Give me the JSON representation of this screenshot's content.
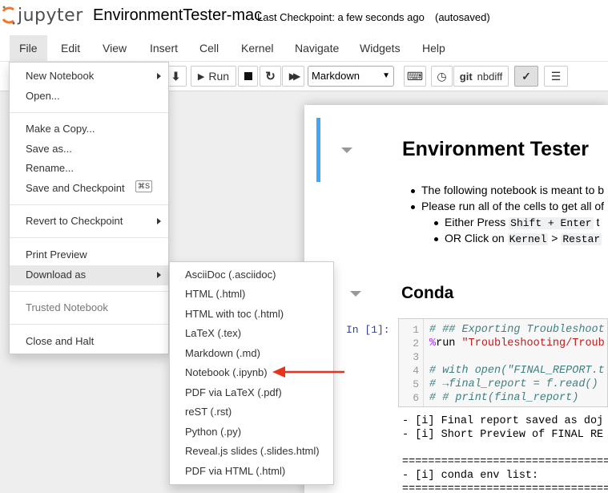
{
  "header": {
    "logo_text": "jupyter",
    "notebook_title": "EnvironmentTester-mac",
    "checkpoint": "Last Checkpoint: a few seconds ago",
    "autosave": "(autosaved)"
  },
  "menubar": [
    "File",
    "Edit",
    "View",
    "Insert",
    "Cell",
    "Kernel",
    "Navigate",
    "Widgets",
    "Help"
  ],
  "toolbar": {
    "run_label": "Run",
    "cell_type": "Markdown",
    "git_label": "git",
    "nbdiff_label": "nbdiff",
    "icons": [
      "arrow-down-icon",
      "play-icon",
      "stop-icon",
      "restart-icon",
      "fast-forward-icon",
      "keyboard-icon",
      "history-icon",
      "git-icon",
      "spellcheck-icon",
      "list-icon"
    ]
  },
  "file_menu": {
    "items": [
      {
        "label": "New Notebook",
        "submenu": true
      },
      {
        "label": "Open..."
      },
      {
        "label": "Make a Copy..."
      },
      {
        "label": "Save as..."
      },
      {
        "label": "Rename..."
      },
      {
        "label": "Save and Checkpoint",
        "shortcut": "⌘S"
      },
      {
        "label": "Revert to Checkpoint",
        "submenu": true
      },
      {
        "label": "Print Preview"
      },
      {
        "label": "Download as",
        "submenu": true,
        "highlighted": true
      },
      {
        "label": "Trusted Notebook",
        "disabled": true
      },
      {
        "label": "Close and Halt"
      }
    ]
  },
  "download_submenu": [
    "AsciiDoc (.asciidoc)",
    "HTML (.html)",
    "HTML with toc (.html)",
    "LaTeX (.tex)",
    "Markdown (.md)",
    "Notebook (.ipynb)",
    "PDF via LaTeX (.pdf)",
    "reST (.rst)",
    "Python (.py)",
    "Reveal.js slides (.slides.html)",
    "PDF via HTML (.html)"
  ],
  "notebook": {
    "heading1": "Environment Tester",
    "bullets": [
      "The following notebook is meant to b",
      "Please run all of the cells to get all of"
    ],
    "sub_bullets": [
      {
        "prefix": "Either Press ",
        "code1": "Shift + Enter",
        "suffix": " t"
      },
      {
        "prefix": "OR Click on ",
        "code1": "Kernel",
        "mid": " > ",
        "code2": "Restar"
      }
    ],
    "heading2": "Conda",
    "prompt": "In [1]:",
    "code_lines": [
      {
        "n": "1",
        "parts": [
          {
            "t": "# ## Exporting Troubleshoot",
            "c": "cm"
          }
        ]
      },
      {
        "n": "2",
        "parts": [
          {
            "t": "%",
            "c": "mg"
          },
          {
            "t": "run ",
            "c": ""
          },
          {
            "t": "\"Troubleshooting/Troub",
            "c": "st"
          }
        ]
      },
      {
        "n": "3",
        "parts": [
          {
            "t": "",
            "c": ""
          }
        ]
      },
      {
        "n": "4",
        "parts": [
          {
            "t": "# with open(\"FINAL_REPORT.t",
            "c": "cm"
          }
        ]
      },
      {
        "n": "5",
        "parts": [
          {
            "t": "# →final_report = f.read()",
            "c": "cm"
          }
        ]
      },
      {
        "n": "6",
        "parts": [
          {
            "t": "# # print(final_report)",
            "c": "cm"
          }
        ]
      }
    ],
    "output_lines": [
      "- [i] Final report saved as doj",
      "- [i] Short Preview of FINAL RE",
      "",
      "================================",
      "- [i] conda env list:",
      "================================"
    ]
  },
  "colors": {
    "accent": "#42a5f5",
    "arrow": "#e8321e",
    "prompt": "#303f9f"
  }
}
